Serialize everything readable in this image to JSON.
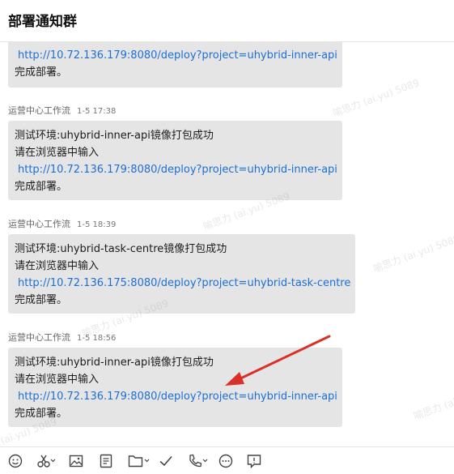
{
  "header": {
    "title": "部署通知群"
  },
  "messages": [
    {
      "sender": "",
      "time": "",
      "lines": [
        "http://10.72.136.179:8080/deploy?project=uhybrid-inner-api",
        "完成部署。"
      ]
    },
    {
      "sender": "运营中心工作流",
      "time": "1-5 17:38",
      "lines": [
        "测试环境:uhybrid-inner-api镜像打包成功",
        "请在浏览器中输入",
        "http://10.72.136.179:8080/deploy?project=uhybrid-inner-api",
        "完成部署。"
      ]
    },
    {
      "sender": "运营中心工作流",
      "time": "1-5 18:39",
      "lines": [
        "测试环境:uhybrid-task-centre镜像打包成功",
        "请在浏览器中输入",
        "http://10.72.136.175:8080/deploy?project=uhybrid-task-centre",
        "完成部署。"
      ]
    },
    {
      "sender": "运营中心工作流",
      "time": "1-5 18:56",
      "lines": [
        "测试环境:uhybrid-inner-api镜像打包成功",
        "请在浏览器中输入",
        "http://10.72.136.179:8080/deploy?project=uhybrid-inner-api",
        "完成部署。"
      ]
    }
  ],
  "watermark": {
    "text": "喻思力 (ai.yu) 5089"
  },
  "toolbar": {
    "icons": [
      "emoji-icon",
      "scissors-icon",
      "image-icon",
      "document-icon",
      "folder-icon",
      "check-icon",
      "phone-icon",
      "more-icon",
      "message-icon"
    ]
  },
  "colors": {
    "link": "#1d6fd6",
    "bubble": "#e5e5e5",
    "annotation_arrow": "#d9302a"
  }
}
